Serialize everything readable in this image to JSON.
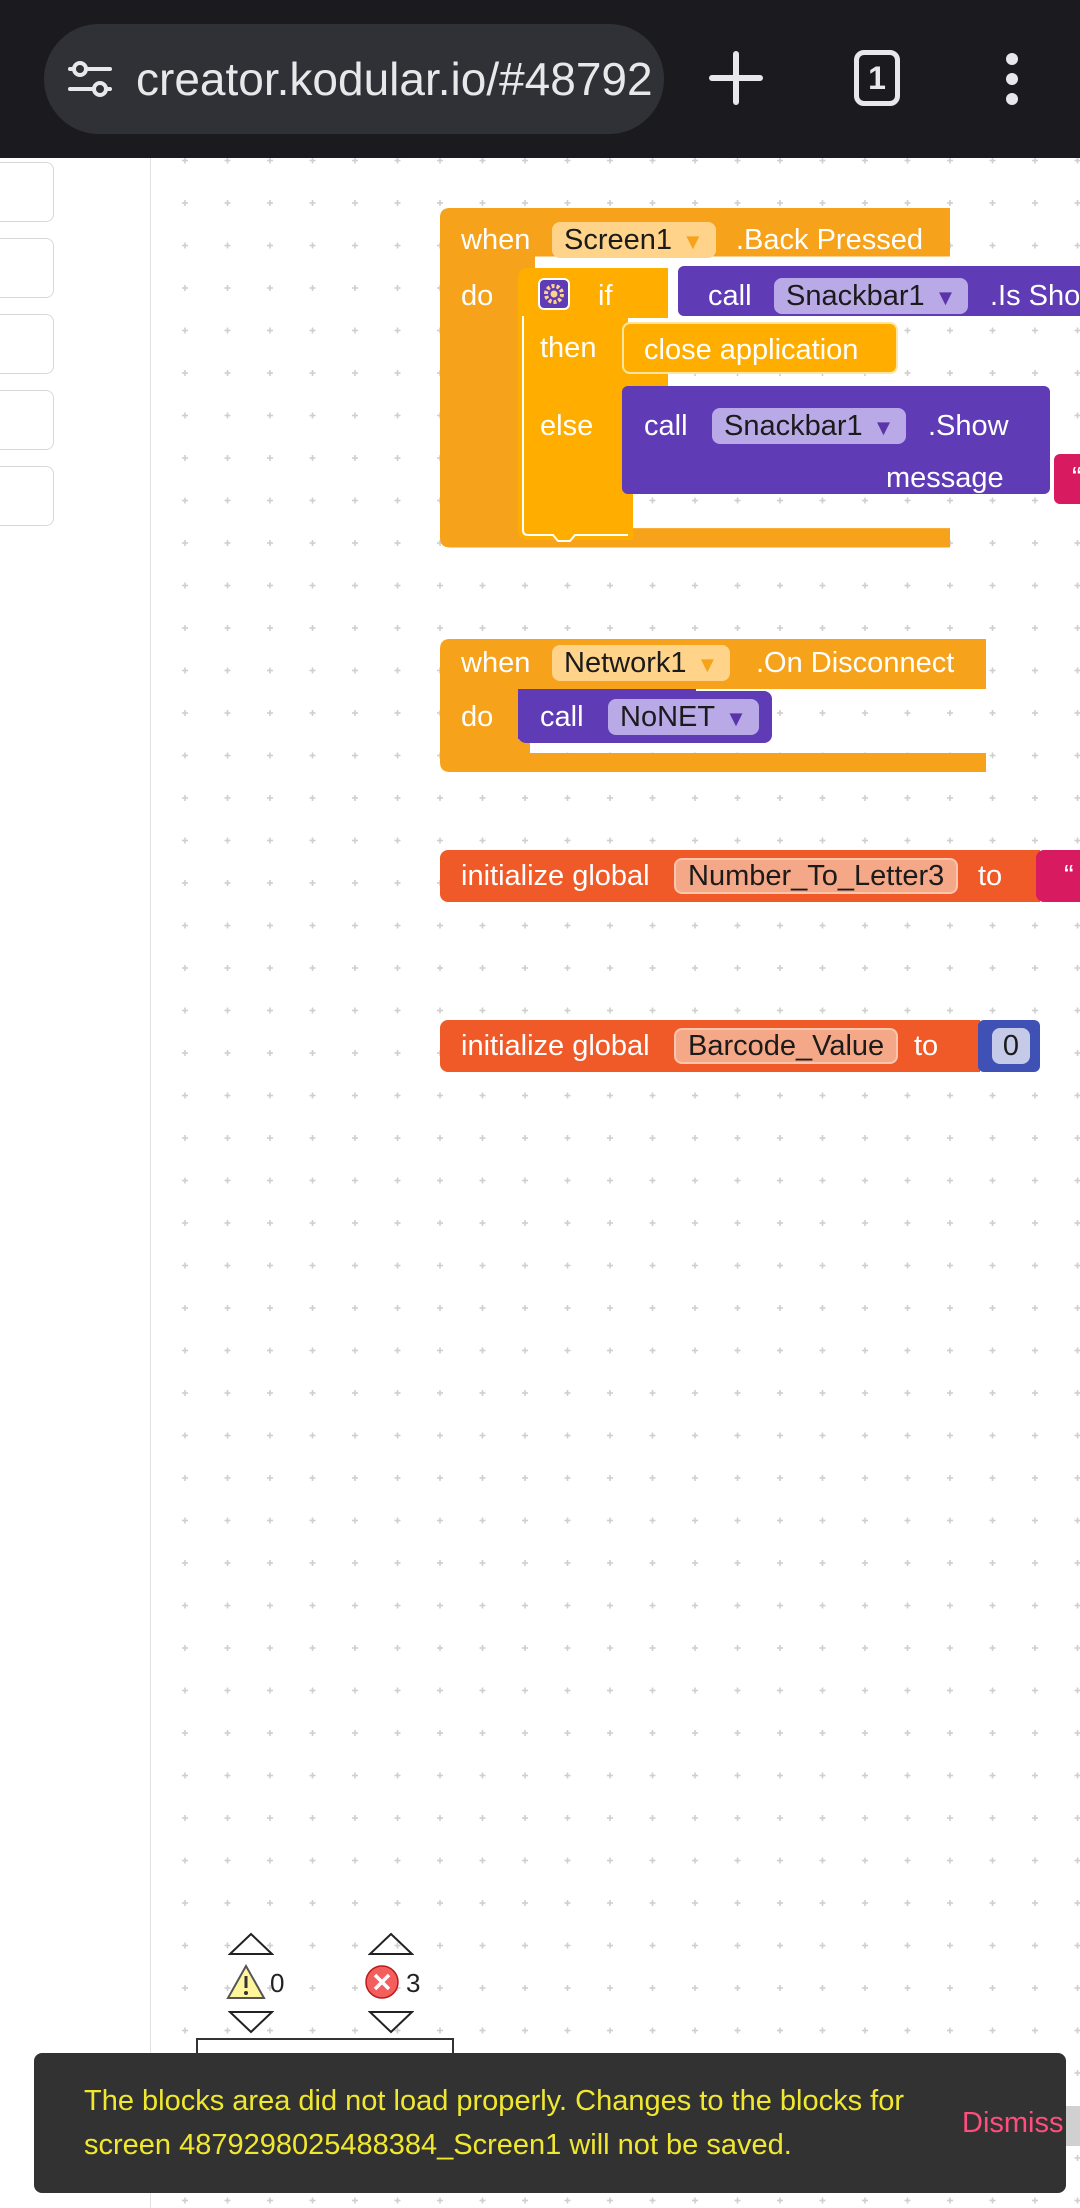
{
  "browser": {
    "url": "creator.kodular.io/#48792",
    "tab_count": "1",
    "icons": [
      "site-settings-icon",
      "plus-icon",
      "tabs-icon",
      "more-vert-icon"
    ]
  },
  "blocks": {
    "back_pressed": {
      "when": "when",
      "component": "Screen1",
      "event": ".Back Pressed",
      "do": "do",
      "if": "if",
      "call1": "call",
      "snackbar1": "Snackbar1",
      "method1": ".Is Sho",
      "then": "then",
      "close": "close application",
      "else": "else",
      "call2": "call",
      "snackbar2": "Snackbar1",
      "method2": ".Show",
      "message": "message",
      "string_start": "“"
    },
    "on_disconnect": {
      "when": "when",
      "component": "Network1",
      "event": ".On Disconnect",
      "do": "do",
      "call": "call",
      "procedure": "NoNET"
    },
    "global_letter": {
      "label": "initialize global",
      "name": "Number_To_Letter3",
      "to": "to",
      "string_start": "“"
    },
    "global_barcode": {
      "label": "initialize global",
      "name": "Barcode_Value",
      "to": "to",
      "value": "0"
    }
  },
  "counters": {
    "warnings": "0",
    "errors": "3"
  },
  "toast": {
    "message": "The blocks area did not load properly. Changes to the blocks for screen 4879298025488384_Screen1 will not be saved.",
    "dismiss": "Dismiss"
  },
  "colors": {
    "event_block": "#f7a21b",
    "control_block": "#ffae00",
    "component_block": "#5f3bb5",
    "variable_block": "#f05a28",
    "text_block": "#d81b60",
    "math_block": "#3f51b5",
    "toast_text": "#f0e830",
    "dismiss": "#ff4d7d"
  }
}
